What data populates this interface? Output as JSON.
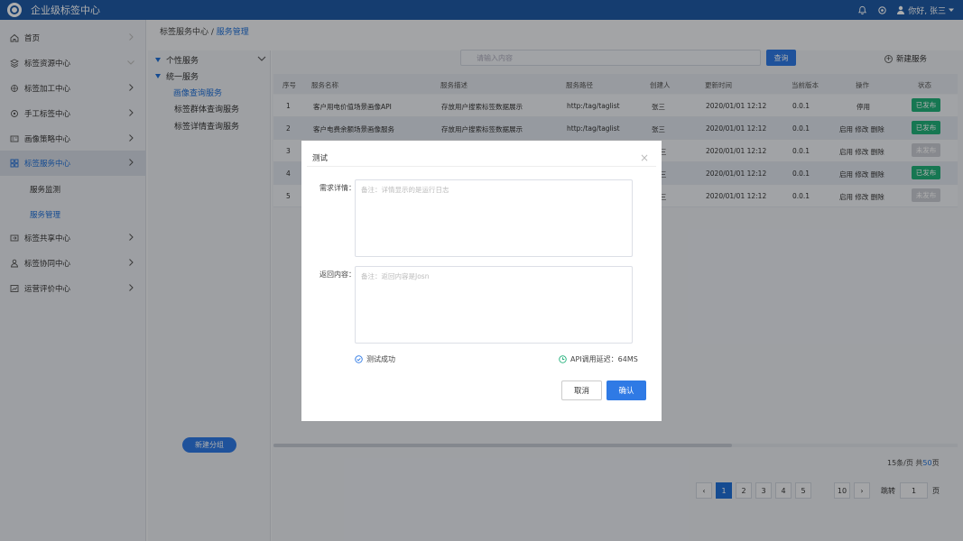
{
  "app": {
    "title": "企业级标签中心",
    "greeting": "你好, 张三"
  },
  "sidebar": {
    "items": [
      {
        "label": "首页"
      },
      {
        "label": "标签资源中心"
      },
      {
        "label": "标签加工中心"
      },
      {
        "label": "手工标签中心"
      },
      {
        "label": "画像策略中心"
      },
      {
        "label": "标签服务中心"
      },
      {
        "label": "标签共享中心"
      },
      {
        "label": "标签协同中心"
      },
      {
        "label": "运营评价中心"
      }
    ],
    "sub_items": [
      {
        "label": "服务监测"
      },
      {
        "label": "服务管理"
      }
    ]
  },
  "breadcrumb": {
    "parent": "标签服务中心 / ",
    "current": "服务管理"
  },
  "tree": {
    "group1": "个性服务",
    "group2": "统一服务",
    "items": [
      {
        "label": "画像查询服务"
      },
      {
        "label": "标签群体查询服务"
      },
      {
        "label": "标签详情查询服务"
      }
    ],
    "new_group": "新建分组"
  },
  "search": {
    "placeholder": "请输入内容",
    "button": "查询"
  },
  "new_service": "新建服务",
  "table": {
    "headers": [
      "序号",
      "服务名称",
      "服务描述",
      "服务路径",
      "创建人",
      "更新时间",
      "当前版本",
      "操作",
      "状态"
    ],
    "rows": [
      {
        "no": "1",
        "name": "客户用电价值场景画像API",
        "desc": "存放用户搜索标签数据展示",
        "path": "http:/tag/taglist",
        "creator": "张三",
        "time": "2020/01/01 12:12",
        "version": "0.0.1",
        "ops": "停用",
        "status": "已发布"
      },
      {
        "no": "2",
        "name": "客户电费余额场景画像服务",
        "desc": "存放用户搜索标签数据展示",
        "path": "http:/tag/taglist",
        "creator": "张三",
        "time": "2020/01/01 12:12",
        "version": "0.0.1",
        "ops": "启用  修改  删除",
        "status": "已发布"
      },
      {
        "no": "3",
        "name": "",
        "desc": "",
        "path": "",
        "creator": "三",
        "time": "2020/01/01 12:12",
        "version": "0.0.1",
        "ops": "启用  修改  删除",
        "status": "未发布"
      },
      {
        "no": "4",
        "name": "",
        "desc": "",
        "path": "",
        "creator": "三",
        "time": "2020/01/01 12:12",
        "version": "0.0.1",
        "ops": "启用  修改  删除",
        "status": "已发布"
      },
      {
        "no": "5",
        "name": "",
        "desc": "",
        "path": "",
        "creator": "三",
        "time": "2020/01/01 12:12",
        "version": "0.0.1",
        "ops": "启用  修改  删除",
        "status": "未发布"
      }
    ]
  },
  "pagination": {
    "summary_prefix": "15条/页  共",
    "total": "50",
    "summary_suffix": "页",
    "pages": [
      "1",
      "2",
      "3",
      "4",
      "5",
      "10"
    ],
    "prev": "‹",
    "next": "›",
    "jump_label": "跳转",
    "jump_value": "1",
    "page_label": "页"
  },
  "modal": {
    "title": "测试",
    "close": "×",
    "request_label": "需求详情：",
    "request_placeholder": "备注：详情显示的是运行日志",
    "response_label": "返回内容：",
    "response_placeholder": "备注：返回内容是Josn",
    "success_text": "测试成功",
    "latency_text": "API调用延迟：64MS",
    "cancel": "取消",
    "confirm": "确认"
  },
  "colors": {
    "primary": "#2f7ae5",
    "header": "#1f5aa6",
    "published": "#21b07a",
    "unpublished": "#c7cbd2"
  }
}
